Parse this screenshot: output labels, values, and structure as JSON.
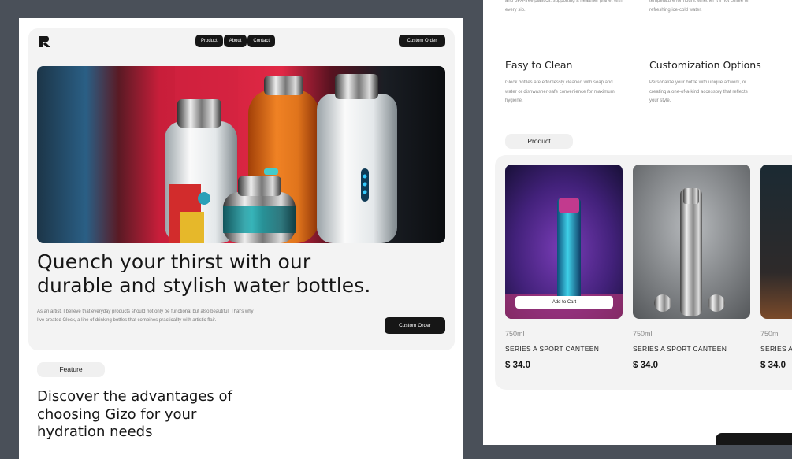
{
  "left": {
    "nav": {
      "product": "Product",
      "about": "About",
      "contact": "Contact"
    },
    "custom_order_top": "Custom Order",
    "hero_title": "Quench your thirst with our durable and stylish water bottles.",
    "hero_desc": "As an artist, I believe that everyday products should not only be functional but also beautiful. That's why I've created Gleck, a line of drinking bottles that combines practicality with artistic flair.",
    "custom_order_bottom": "Custom Order",
    "feature_label": "Feature",
    "feature_title": "Discover the advantages of choosing Gizo for your hydration needs"
  },
  "right": {
    "top_snippet_1": "and BPA-free plastics, supporting a healthier planet with every sip.",
    "top_snippet_2": "temperature for hours, whether it's hot coffee or refreshing ice-cold water.",
    "easy_title": "Easy to Clean",
    "easy_desc": "Gleck bottles are effortlessly cleaned with soap and water or dishwasher-safe convenience for maximum hygiene.",
    "custom_title": "Customization Options",
    "custom_desc": "Personalize your bottle with unique artwork, or creating a one-of-a-kind accessory that reflects your style.",
    "product_label": "Product",
    "add_to_cart": "Add to Cart",
    "products": [
      {
        "capacity": "750ml",
        "name": "SERIES A SPORT CANTEEN",
        "price": "$ 34.0"
      },
      {
        "capacity": "750ml",
        "name": "SERIES A SPORT CANTEEN",
        "price": "$ 34.0"
      },
      {
        "capacity": "750ml",
        "name": "SERIES A",
        "price": "$ 34.0"
      }
    ]
  },
  "colors": {
    "background": "#4a5059",
    "card": "#f3f3f3",
    "dark": "#161616"
  }
}
